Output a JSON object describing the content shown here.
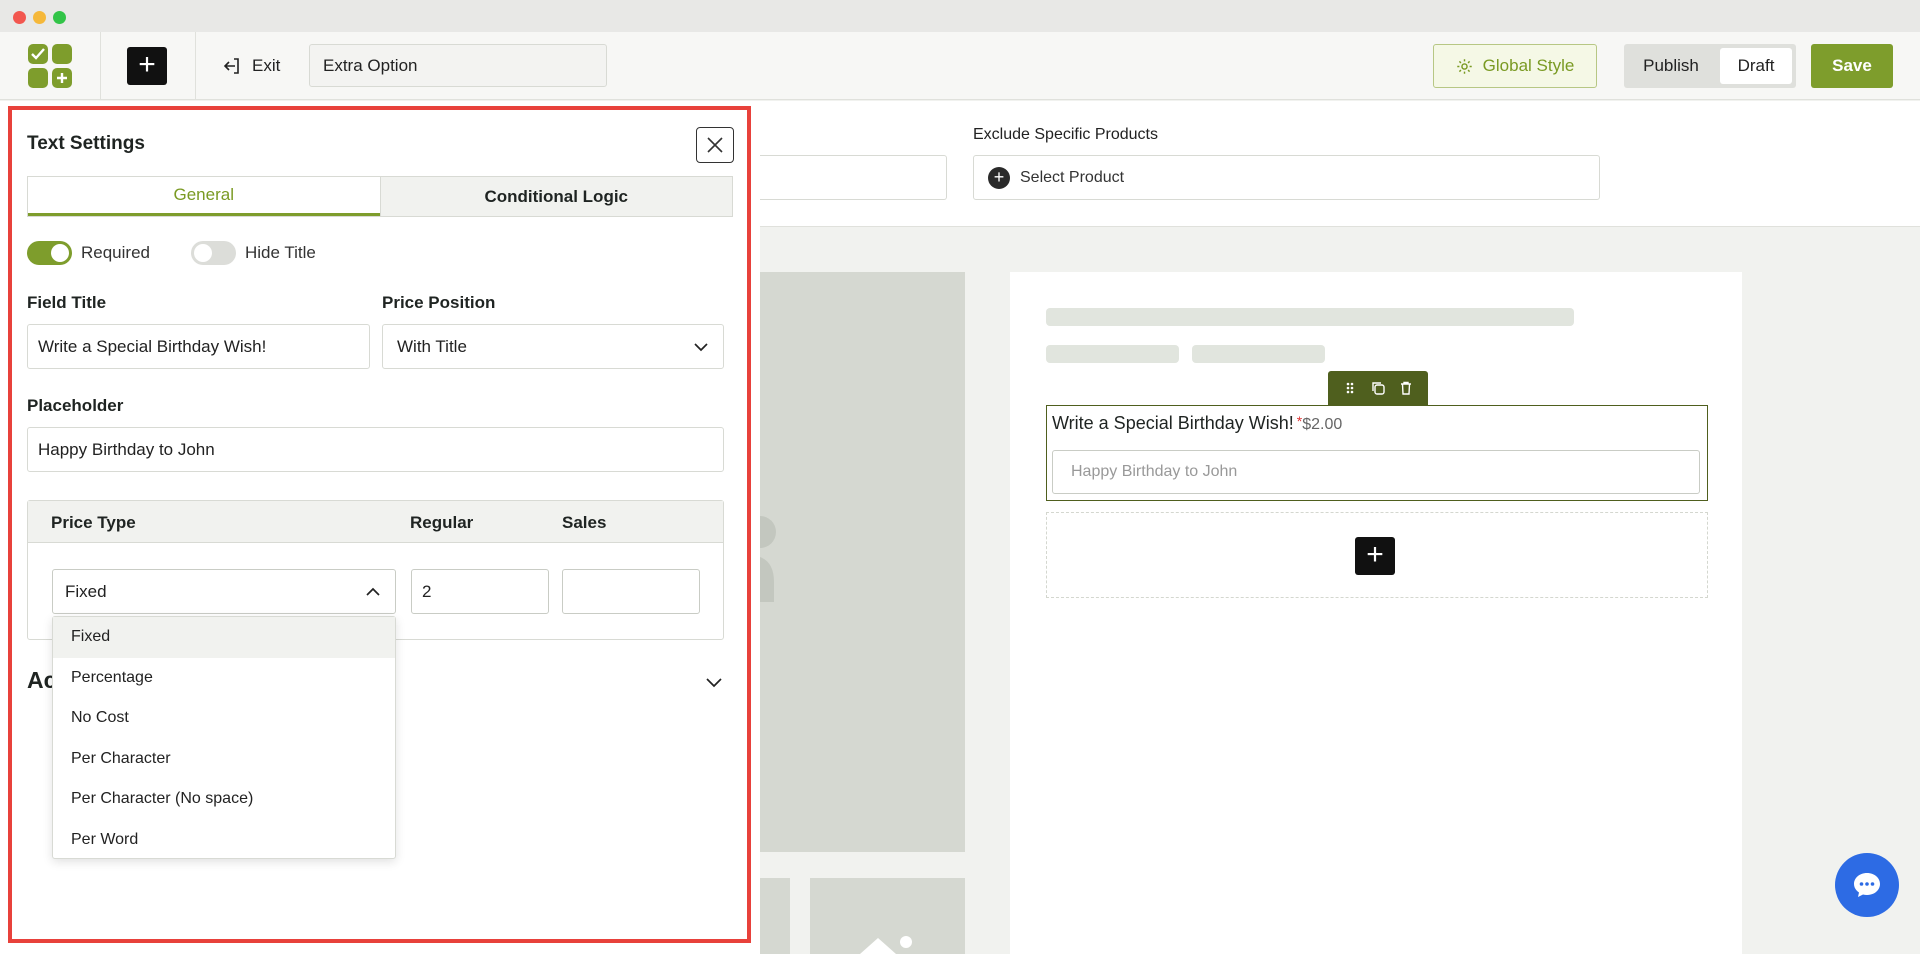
{
  "toolbar": {
    "exit_label": "Exit",
    "title_value": "Extra Option",
    "global_style_label": "Global Style",
    "publish_label": "Publish",
    "draft_label": "Draft",
    "save_label": "Save",
    "accent_color": "#7e9d2c"
  },
  "canvas": {
    "exclude_label": "Exclude Specific Products",
    "select_product_label": "Select Product",
    "preview_field": {
      "title": "Write a Special Birthday Wish!",
      "required_mark": "*",
      "price": "$2.00",
      "placeholder": "Happy Birthday to John"
    }
  },
  "panel": {
    "title": "Text Settings",
    "tabs": [
      {
        "label": "General",
        "active": true
      },
      {
        "label": "Conditional Logic",
        "active": false
      }
    ],
    "required_toggle": {
      "label": "Required",
      "on": true
    },
    "hide_title_toggle": {
      "label": "Hide Title",
      "on": false
    },
    "field_title_label": "Field Title",
    "field_title_value": "Write a Special Birthday Wish!",
    "price_position_label": "Price Position",
    "price_position_value": "With Title",
    "placeholder_label": "Placeholder",
    "placeholder_value": "Happy Birthday to John",
    "price_table": {
      "col_price_type": "Price Type",
      "col_regular": "Regular",
      "col_sales": "Sales",
      "price_type_value": "Fixed",
      "regular_value": "2",
      "sales_value": ""
    },
    "advanced_label": "Ac",
    "price_type_options": [
      "Fixed",
      "Percentage",
      "No Cost",
      "Per Character",
      "Per Character (No space)",
      "Per Word"
    ],
    "price_type_selected_index": 0
  }
}
